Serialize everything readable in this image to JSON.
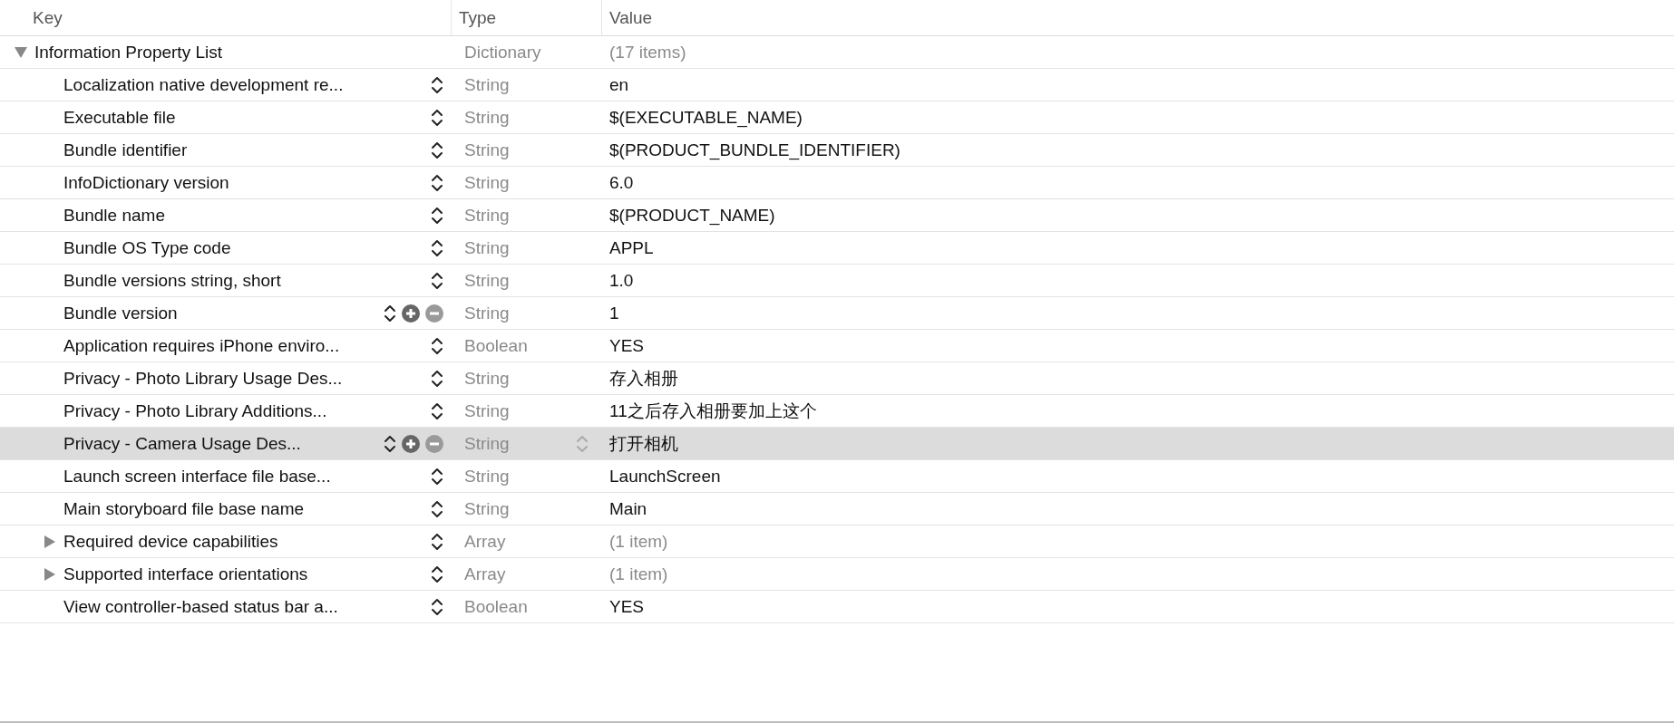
{
  "columns": [
    "Key",
    "Type",
    "Value"
  ],
  "root": {
    "key": "Information Property List",
    "type": "Dictionary",
    "value": "(17 items)",
    "kind": "group",
    "expanded": true,
    "children": [
      {
        "key": "Localization native development re...",
        "type": "String",
        "value": "en",
        "kind": "item",
        "selected": false,
        "hovered": false
      },
      {
        "key": "Executable file",
        "type": "String",
        "value": "$(EXECUTABLE_NAME)",
        "kind": "item",
        "selected": false,
        "hovered": false
      },
      {
        "key": "Bundle identifier",
        "type": "String",
        "value": "$(PRODUCT_BUNDLE_IDENTIFIER)",
        "kind": "item",
        "selected": false,
        "hovered": false
      },
      {
        "key": "InfoDictionary version",
        "type": "String",
        "value": "6.0",
        "kind": "item",
        "selected": false,
        "hovered": false
      },
      {
        "key": "Bundle name",
        "type": "String",
        "value": "$(PRODUCT_NAME)",
        "kind": "item",
        "selected": false,
        "hovered": false
      },
      {
        "key": "Bundle OS Type code",
        "type": "String",
        "value": "APPL",
        "kind": "item",
        "selected": false,
        "hovered": false
      },
      {
        "key": "Bundle versions string, short",
        "type": "String",
        "value": "1.0",
        "kind": "item",
        "selected": false,
        "hovered": false
      },
      {
        "key": "Bundle version",
        "type": "String",
        "value": "1",
        "kind": "item",
        "selected": false,
        "hovered": true
      },
      {
        "key": "Application requires iPhone enviro...",
        "type": "Boolean",
        "value": "YES",
        "kind": "item",
        "selected": false,
        "hovered": false
      },
      {
        "key": "Privacy - Photo Library Usage Des...",
        "type": "String",
        "value": "存入相册",
        "kind": "item",
        "selected": false,
        "hovered": false
      },
      {
        "key": "Privacy - Photo Library Additions...",
        "type": "String",
        "value": "11之后存入相册要加上这个",
        "kind": "item",
        "selected": false,
        "hovered": false
      },
      {
        "key": "Privacy - Camera Usage Des...",
        "type": "String",
        "value": "打开相机",
        "kind": "item",
        "selected": true
      },
      {
        "key": "Launch screen interface file base...",
        "type": "String",
        "value": "LaunchScreen",
        "kind": "item",
        "selected": false,
        "hovered": false
      },
      {
        "key": "Main storyboard file base name",
        "type": "String",
        "value": "Main",
        "kind": "item",
        "selected": false,
        "hovered": false
      },
      {
        "key": "Required device capabilities",
        "type": "Array",
        "value": "(1 item)",
        "kind": "group",
        "expanded": false,
        "selected": false,
        "hovered": false
      },
      {
        "key": "Supported interface orientations",
        "type": "Array",
        "value": "(1 item)",
        "kind": "group",
        "expanded": false,
        "selected": false,
        "hovered": false
      },
      {
        "key": "View controller-based status bar a...",
        "type": "Boolean",
        "value": "YES",
        "kind": "item",
        "selected": false,
        "hovered": false
      }
    ]
  }
}
